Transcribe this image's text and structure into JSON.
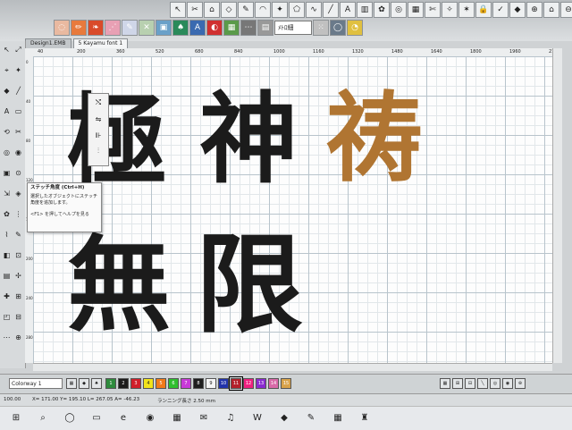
{
  "toolbar": {
    "row1_icons": [
      "cursor-icon",
      "sew-icon",
      "node-icon",
      "shape-icon",
      "pen-icon",
      "arc-icon",
      "star-icon",
      "polygon-icon",
      "curve-icon",
      "line-icon",
      "text-icon",
      "fill-icon",
      "knot-icon",
      "target-icon",
      "grid-icon",
      "scissors-icon",
      "magic-icon",
      "wand-icon",
      "lock-icon",
      "ok-icon",
      "palette-icon",
      "zoom-in-icon",
      "home-icon",
      "zoom-out-icon",
      "help-icon"
    ],
    "row1_glyphs": [
      "↖",
      "✂",
      "⌂",
      "◇",
      "✎",
      "◠",
      "✦",
      "⬠",
      "∿",
      "╱",
      "A",
      "▥",
      "✿",
      "◎",
      "▦",
      "✄",
      "✧",
      "✶",
      "🔒",
      "✓",
      "◆",
      "⊕",
      "⌂",
      "⊖",
      "?"
    ],
    "row2_icons": [
      "bean-icon",
      "tatami-icon",
      "leaf-icon",
      "satin-icon",
      "pencil-icon",
      "cross-icon",
      "image-icon",
      "figure-icon",
      "lettering-icon",
      "color-icon",
      "palette-icon",
      "stitch-icon",
      "table-icon",
      "stitch-icon",
      "ellipse-icon",
      "clock-icon"
    ],
    "row2_glyphs": [
      "◌",
      "✏",
      "❧",
      "⋰",
      "✎",
      "✕",
      "▣",
      "♠",
      "A",
      "◐",
      "▦",
      "⋯",
      "▤",
      "⁙",
      "◯",
      "◔"
    ],
    "font_combo": "ﾒﾄﾛ細"
  },
  "tabs": [
    {
      "label": "Design1.EMB"
    },
    {
      "label": "5 Kayamu font 1"
    }
  ],
  "left_tools": [
    "↖",
    "⤢",
    "⌖",
    "✦",
    "◆",
    "╱",
    "A",
    "▭",
    "⟲",
    "✂",
    "◎",
    "◉",
    "▣",
    "⊙",
    "⇲",
    "◈",
    "✿",
    "⋮",
    "⌇",
    "✎",
    "◧",
    "⊡",
    "▤",
    "✢",
    "✚",
    "⊞",
    "◰",
    "⊟",
    "⋯",
    "⊕"
  ],
  "ruler_top": [
    "40",
    "200",
    "360",
    "520",
    "680",
    "840",
    "1000",
    "1160",
    "1320",
    "1480",
    "1640",
    "1800",
    "1960",
    "2120"
  ],
  "ruler_left": [
    "0",
    "40",
    "80",
    "120",
    "160",
    "200",
    "240",
    "280"
  ],
  "kanji": [
    {
      "char": "極",
      "color": "#1b1b1b"
    },
    {
      "char": "神",
      "color": "#1b1b1b"
    },
    {
      "char": "祷",
      "color": "#b07532"
    },
    {
      "char": "無",
      "color": "#1b1b1b"
    },
    {
      "char": "限",
      "color": "#1b1b1b"
    }
  ],
  "flyout_icons": [
    "⤭",
    "⇋",
    "⊪",
    "⫶"
  ],
  "tooltip": {
    "title": "ステッチ角度 (Ctrl+H)",
    "body": "選択したオブジェクトにステッチ角度を追加します。",
    "help": "<F1> を押してヘルプを見る"
  },
  "colorbar": {
    "colorway": "Colorway 1",
    "swatches": [
      {
        "label": "1",
        "color": "#2e8b3d"
      },
      {
        "label": "2",
        "color": "#1c1c1c"
      },
      {
        "label": "3",
        "color": "#d01f2b"
      },
      {
        "label": "4",
        "color": "#f2e31a"
      },
      {
        "label": "5",
        "color": "#f27a1a"
      },
      {
        "label": "6",
        "color": "#2fbf2f"
      },
      {
        "label": "7",
        "color": "#c83ad8"
      },
      {
        "label": "8",
        "color": "#1e1e1e"
      },
      {
        "label": "9",
        "color": "#f5f5f5"
      },
      {
        "label": "10",
        "color": "#2233aa"
      },
      {
        "label": "11",
        "color": "#b3202a"
      },
      {
        "label": "12",
        "color": "#ee2080"
      },
      {
        "label": "13",
        "color": "#8a2bd0"
      },
      {
        "label": "14",
        "color": "#d86aa8"
      },
      {
        "label": "15",
        "color": "#d8a24a"
      }
    ],
    "tools": [
      "▦",
      "⊞",
      "⊟",
      "╲",
      "◎",
      "◉",
      "⊛"
    ]
  },
  "status": {
    "left": "100.00",
    "coords": "X= 171.00 Y= 195.10 L= 267.05 A= -46.23",
    "running": "ランニング長さ 2.50 mm"
  },
  "taskbar": {
    "icons": [
      "⊞",
      "⌕",
      "◯",
      "▭",
      "e",
      "◉",
      "▦",
      "✉",
      "♫",
      "W",
      "◆",
      "✎",
      "▦",
      "♜"
    ]
  }
}
